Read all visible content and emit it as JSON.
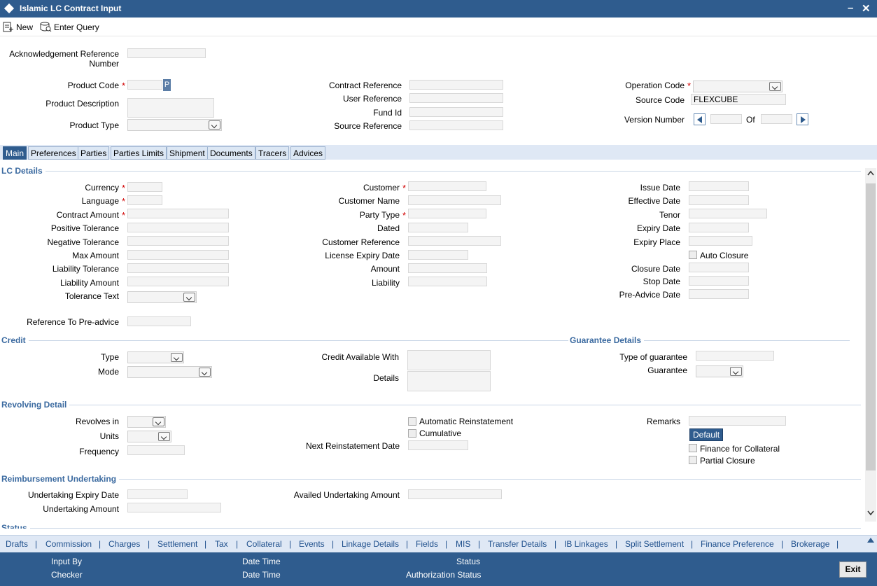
{
  "window": {
    "title": "Islamic LC Contract Input"
  },
  "toolbar": {
    "new_label": "New",
    "enter_query_label": "Enter Query"
  },
  "header": {
    "ack_ref_line1": "Acknowledgement Reference",
    "ack_ref_line2": "Number",
    "product_code": "Product Code",
    "product_description": "Product Description",
    "product_type": "Product Type",
    "p_button": "P",
    "contract_reference": "Contract Reference",
    "user_reference": "User Reference",
    "fund_id": "Fund Id",
    "source_reference": "Source Reference",
    "operation_code": "Operation Code",
    "source_code": "Source Code",
    "source_code_value": "FLEXCUBE",
    "version_number": "Version Number",
    "of": "Of"
  },
  "tabs": [
    "Main",
    "Preferences",
    "Parties",
    "Parties Limits",
    "Shipment",
    "Documents",
    "Tracers",
    "Advices"
  ],
  "lc_details": {
    "section": "LC Details",
    "currency": "Currency",
    "language": "Language",
    "contract_amount": "Contract Amount",
    "positive_tolerance": "Positive Tolerance",
    "negative_tolerance": "Negative Tolerance",
    "max_amount": "Max Amount",
    "liability_tolerance": "Liability Tolerance",
    "liability_amount": "Liability Amount",
    "tolerance_text": "Tolerance Text",
    "ref_pre_advice": "Reference To Pre-advice",
    "customer": "Customer",
    "customer_name": "Customer Name",
    "party_type": "Party Type",
    "dated": "Dated",
    "customer_reference": "Customer Reference",
    "license_expiry_date": "License Expiry Date",
    "amount": "Amount",
    "liability": "Liability",
    "issue_date": "Issue Date",
    "effective_date": "Effective Date",
    "tenor": "Tenor",
    "expiry_date": "Expiry Date",
    "expiry_place": "Expiry Place",
    "auto_closure": "Auto Closure",
    "closure_date": "Closure Date",
    "stop_date": "Stop Date",
    "pre_advice_date": "Pre-Advice Date"
  },
  "credit": {
    "section": "Credit",
    "type": "Type",
    "mode": "Mode",
    "credit_available_with": "Credit Available With",
    "details": "Details"
  },
  "guarantee": {
    "section": "Guarantee Details",
    "type_of_guarantee": "Type of guarantee",
    "guarantee": "Guarantee"
  },
  "revolving": {
    "section": "Revolving Detail",
    "revolves_in": "Revolves in",
    "units": "Units",
    "frequency": "Frequency",
    "automatic_reinstatement": "Automatic Reinstatement",
    "cumulative": "Cumulative",
    "next_reinstatement_date": "Next Reinstatement Date",
    "remarks": "Remarks",
    "default_button": "Default",
    "finance_for_collateral": "Finance for Collateral",
    "partial_closure": "Partial Closure"
  },
  "reimbursement": {
    "section": "Reimbursement Undertaking",
    "undertaking_expiry_date": "Undertaking Expiry Date",
    "undertaking_amount": "Undertaking Amount",
    "availed_undertaking_amount": "Availed Undertaking Amount"
  },
  "status_section": "Status",
  "subsystems": [
    "Drafts",
    "Commission",
    "Charges",
    "Settlement",
    "Tax",
    "Collateral",
    "Events",
    "Linkage Details",
    "Fields",
    "MIS",
    "Transfer Details",
    "IB Linkages",
    "Split Settlement",
    "Finance Preference",
    "Brokerage"
  ],
  "footer": {
    "input_by": "Input By",
    "checker": "Checker",
    "date_time": "Date Time",
    "status": "Status",
    "authorization_status": "Authorization Status",
    "exit": "Exit"
  },
  "colors": {
    "accent": "#2f5c8e",
    "section": "#3b6aa0",
    "required": "#d00000"
  }
}
